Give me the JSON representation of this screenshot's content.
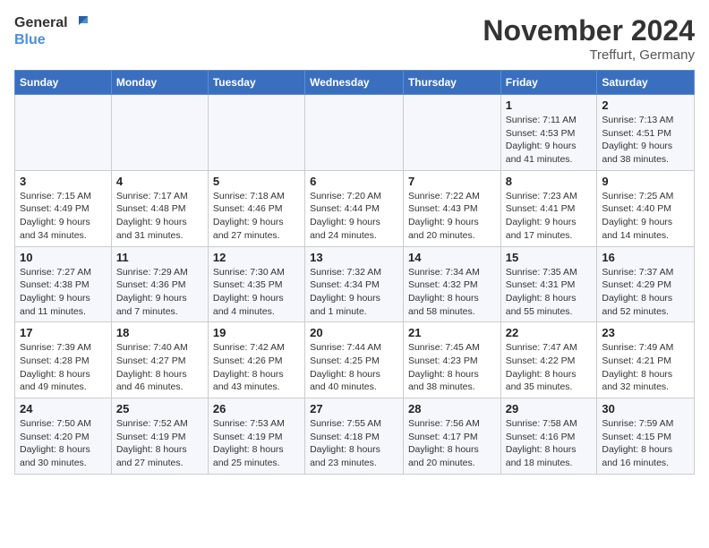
{
  "header": {
    "logo_line1": "General",
    "logo_line2": "Blue",
    "month": "November 2024",
    "location": "Treffurt, Germany"
  },
  "weekdays": [
    "Sunday",
    "Monday",
    "Tuesday",
    "Wednesday",
    "Thursday",
    "Friday",
    "Saturday"
  ],
  "weeks": [
    [
      {
        "day": "",
        "info": ""
      },
      {
        "day": "",
        "info": ""
      },
      {
        "day": "",
        "info": ""
      },
      {
        "day": "",
        "info": ""
      },
      {
        "day": "",
        "info": ""
      },
      {
        "day": "1",
        "info": "Sunrise: 7:11 AM\nSunset: 4:53 PM\nDaylight: 9 hours\nand 41 minutes."
      },
      {
        "day": "2",
        "info": "Sunrise: 7:13 AM\nSunset: 4:51 PM\nDaylight: 9 hours\nand 38 minutes."
      }
    ],
    [
      {
        "day": "3",
        "info": "Sunrise: 7:15 AM\nSunset: 4:49 PM\nDaylight: 9 hours\nand 34 minutes."
      },
      {
        "day": "4",
        "info": "Sunrise: 7:17 AM\nSunset: 4:48 PM\nDaylight: 9 hours\nand 31 minutes."
      },
      {
        "day": "5",
        "info": "Sunrise: 7:18 AM\nSunset: 4:46 PM\nDaylight: 9 hours\nand 27 minutes."
      },
      {
        "day": "6",
        "info": "Sunrise: 7:20 AM\nSunset: 4:44 PM\nDaylight: 9 hours\nand 24 minutes."
      },
      {
        "day": "7",
        "info": "Sunrise: 7:22 AM\nSunset: 4:43 PM\nDaylight: 9 hours\nand 20 minutes."
      },
      {
        "day": "8",
        "info": "Sunrise: 7:23 AM\nSunset: 4:41 PM\nDaylight: 9 hours\nand 17 minutes."
      },
      {
        "day": "9",
        "info": "Sunrise: 7:25 AM\nSunset: 4:40 PM\nDaylight: 9 hours\nand 14 minutes."
      }
    ],
    [
      {
        "day": "10",
        "info": "Sunrise: 7:27 AM\nSunset: 4:38 PM\nDaylight: 9 hours\nand 11 minutes."
      },
      {
        "day": "11",
        "info": "Sunrise: 7:29 AM\nSunset: 4:36 PM\nDaylight: 9 hours\nand 7 minutes."
      },
      {
        "day": "12",
        "info": "Sunrise: 7:30 AM\nSunset: 4:35 PM\nDaylight: 9 hours\nand 4 minutes."
      },
      {
        "day": "13",
        "info": "Sunrise: 7:32 AM\nSunset: 4:34 PM\nDaylight: 9 hours\nand 1 minute."
      },
      {
        "day": "14",
        "info": "Sunrise: 7:34 AM\nSunset: 4:32 PM\nDaylight: 8 hours\nand 58 minutes."
      },
      {
        "day": "15",
        "info": "Sunrise: 7:35 AM\nSunset: 4:31 PM\nDaylight: 8 hours\nand 55 minutes."
      },
      {
        "day": "16",
        "info": "Sunrise: 7:37 AM\nSunset: 4:29 PM\nDaylight: 8 hours\nand 52 minutes."
      }
    ],
    [
      {
        "day": "17",
        "info": "Sunrise: 7:39 AM\nSunset: 4:28 PM\nDaylight: 8 hours\nand 49 minutes."
      },
      {
        "day": "18",
        "info": "Sunrise: 7:40 AM\nSunset: 4:27 PM\nDaylight: 8 hours\nand 46 minutes."
      },
      {
        "day": "19",
        "info": "Sunrise: 7:42 AM\nSunset: 4:26 PM\nDaylight: 8 hours\nand 43 minutes."
      },
      {
        "day": "20",
        "info": "Sunrise: 7:44 AM\nSunset: 4:25 PM\nDaylight: 8 hours\nand 40 minutes."
      },
      {
        "day": "21",
        "info": "Sunrise: 7:45 AM\nSunset: 4:23 PM\nDaylight: 8 hours\nand 38 minutes."
      },
      {
        "day": "22",
        "info": "Sunrise: 7:47 AM\nSunset: 4:22 PM\nDaylight: 8 hours\nand 35 minutes."
      },
      {
        "day": "23",
        "info": "Sunrise: 7:49 AM\nSunset: 4:21 PM\nDaylight: 8 hours\nand 32 minutes."
      }
    ],
    [
      {
        "day": "24",
        "info": "Sunrise: 7:50 AM\nSunset: 4:20 PM\nDaylight: 8 hours\nand 30 minutes."
      },
      {
        "day": "25",
        "info": "Sunrise: 7:52 AM\nSunset: 4:19 PM\nDaylight: 8 hours\nand 27 minutes."
      },
      {
        "day": "26",
        "info": "Sunrise: 7:53 AM\nSunset: 4:19 PM\nDaylight: 8 hours\nand 25 minutes."
      },
      {
        "day": "27",
        "info": "Sunrise: 7:55 AM\nSunset: 4:18 PM\nDaylight: 8 hours\nand 23 minutes."
      },
      {
        "day": "28",
        "info": "Sunrise: 7:56 AM\nSunset: 4:17 PM\nDaylight: 8 hours\nand 20 minutes."
      },
      {
        "day": "29",
        "info": "Sunrise: 7:58 AM\nSunset: 4:16 PM\nDaylight: 8 hours\nand 18 minutes."
      },
      {
        "day": "30",
        "info": "Sunrise: 7:59 AM\nSunset: 4:15 PM\nDaylight: 8 hours\nand 16 minutes."
      }
    ]
  ]
}
